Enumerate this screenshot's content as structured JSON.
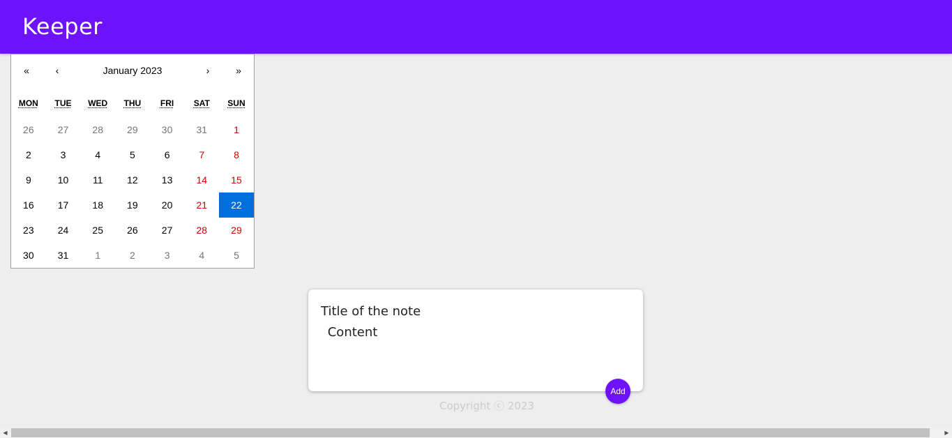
{
  "header": {
    "logo": "Keeper",
    "background_color": "#6d12fa"
  },
  "calendar": {
    "nav": {
      "prev2": "«",
      "prev": "‹",
      "label": "January 2023",
      "next": "›",
      "next2": "»"
    },
    "weekdays": [
      "MON",
      "TUE",
      "WED",
      "THU",
      "FRI",
      "SAT",
      "SUN"
    ],
    "days": [
      {
        "label": "26",
        "state": "neighbor"
      },
      {
        "label": "27",
        "state": "neighbor"
      },
      {
        "label": "28",
        "state": "neighbor"
      },
      {
        "label": "29",
        "state": "neighbor"
      },
      {
        "label": "30",
        "state": "neighbor"
      },
      {
        "label": "31",
        "state": "neighbor"
      },
      {
        "label": "1",
        "state": "weekend"
      },
      {
        "label": "2",
        "state": "normal"
      },
      {
        "label": "3",
        "state": "normal"
      },
      {
        "label": "4",
        "state": "normal"
      },
      {
        "label": "5",
        "state": "normal"
      },
      {
        "label": "6",
        "state": "normal"
      },
      {
        "label": "7",
        "state": "weekend"
      },
      {
        "label": "8",
        "state": "weekend"
      },
      {
        "label": "9",
        "state": "normal"
      },
      {
        "label": "10",
        "state": "normal"
      },
      {
        "label": "11",
        "state": "normal"
      },
      {
        "label": "12",
        "state": "normal"
      },
      {
        "label": "13",
        "state": "normal"
      },
      {
        "label": "14",
        "state": "weekend"
      },
      {
        "label": "15",
        "state": "weekend"
      },
      {
        "label": "16",
        "state": "normal"
      },
      {
        "label": "17",
        "state": "normal"
      },
      {
        "label": "18",
        "state": "normal"
      },
      {
        "label": "19",
        "state": "normal"
      },
      {
        "label": "20",
        "state": "normal"
      },
      {
        "label": "21",
        "state": "weekend"
      },
      {
        "label": "22",
        "state": "active"
      },
      {
        "label": "23",
        "state": "normal"
      },
      {
        "label": "24",
        "state": "normal"
      },
      {
        "label": "25",
        "state": "normal"
      },
      {
        "label": "26",
        "state": "normal"
      },
      {
        "label": "27",
        "state": "normal"
      },
      {
        "label": "28",
        "state": "weekend"
      },
      {
        "label": "29",
        "state": "weekend"
      },
      {
        "label": "30",
        "state": "normal"
      },
      {
        "label": "31",
        "state": "normal"
      },
      {
        "label": "1",
        "state": "neighbor"
      },
      {
        "label": "2",
        "state": "neighbor"
      },
      {
        "label": "3",
        "state": "neighbor"
      },
      {
        "label": "4",
        "state": "neighbor"
      },
      {
        "label": "5",
        "state": "neighbor"
      }
    ],
    "colors": {
      "active": "#006edc",
      "weekend": "#d10000",
      "neighbor": "#757575"
    }
  },
  "note_form": {
    "title_placeholder": "Title of the note",
    "content_placeholder": " Content",
    "add_label": "Add"
  },
  "footer": {
    "text": "Copyright ⓒ 2023"
  },
  "scrollbar": {
    "left_arrow": "◀",
    "right_arrow": "▶"
  }
}
